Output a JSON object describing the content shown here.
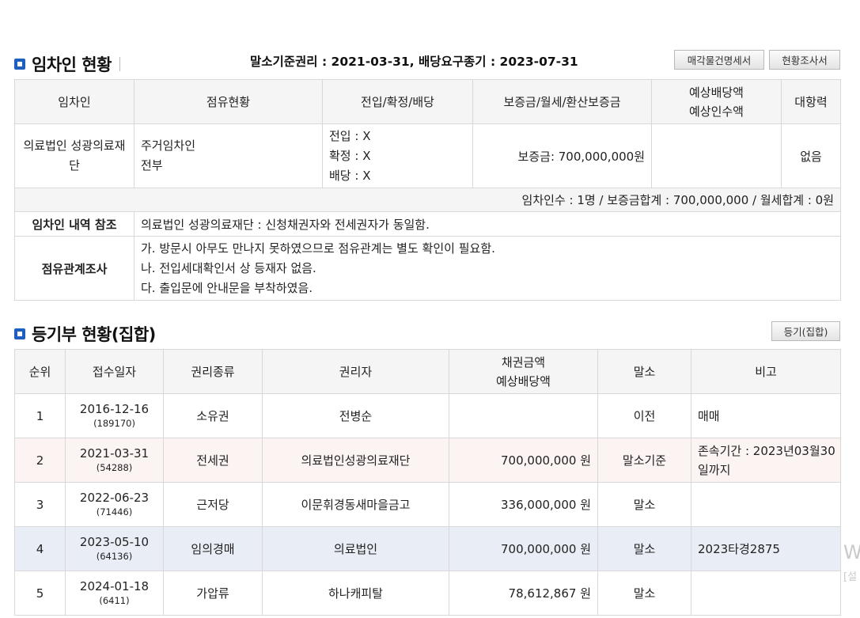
{
  "tenant_section": {
    "title": "임차인 현황",
    "criteria": "말소기준권리 : 2021-03-31, 배당요구종기 : 2023-07-31",
    "buttons": [
      "매각물건명세서",
      "현황조사서"
    ],
    "headers": [
      "임차인",
      "점유현황",
      "전입/확정/배당",
      "보증금/월세/환산보증금",
      "예상배당액",
      "예상인수액",
      "대항력"
    ],
    "row": {
      "tenant": "의료법인 성광의료재단",
      "occupancy_type": "주거임차인",
      "occupancy_part": "전부",
      "move_in": "전입 : X",
      "confirm": "확정 : X",
      "dividend": "배당 : X",
      "deposit": "보증금: 700,000,000원",
      "expected": "",
      "opposition": "없음"
    },
    "summary": "임차인수 : 1명 / 보증금합계 : 700,000,000 / 월세합계 : 0원",
    "note_label": "임차인 내역 참조",
    "note_text": "의료법인 성광의료재단 : 신청채권자와 전세권자가 동일함.",
    "survey_label": "점유관계조사",
    "survey_lines": [
      "가. 방문시 아무도 만나지 못하였으므로 점유관계는 별도 확인이 필요함.",
      "나. 전입세대확인서 상 등재자 없음.",
      "다. 출입문에 안내문을 부착하였음."
    ]
  },
  "registry_section": {
    "title": "등기부 현황(집합)",
    "button": "등기(집합)",
    "headers": [
      "순위",
      "접수일자",
      "권리종류",
      "권리자",
      "채권금액",
      "예상배당액",
      "말소",
      "비고"
    ],
    "rows": [
      {
        "rank": "1",
        "date": "2016-12-16",
        "receipt": "(189170)",
        "type": "소유권",
        "holder": "전병순",
        "amount": "",
        "cancel": "이전",
        "note1": "매매",
        "note2": ""
      },
      {
        "rank": "2",
        "date": "2021-03-31",
        "receipt": "(54288)",
        "type": "전세권",
        "holder": "의료법인성광의료재단",
        "amount": "700,000,000 원",
        "cancel": "말소기준",
        "note1": "존속기간 : 2023년03월30",
        "note2": "일까지"
      },
      {
        "rank": "3",
        "date": "2022-06-23",
        "receipt": "(71446)",
        "type": "근저당",
        "holder": "이문휘경동새마을금고",
        "amount": "336,000,000 원",
        "cancel": "말소",
        "note1": "",
        "note2": ""
      },
      {
        "rank": "4",
        "date": "2023-05-10",
        "receipt": "(64136)",
        "type": "임의경매",
        "holder": "의료법인",
        "amount": "700,000,000 원",
        "cancel": "말소",
        "note1": "2023타경2875",
        "note2": ""
      },
      {
        "rank": "5",
        "date": "2024-01-18",
        "receipt": "(6411)",
        "type": "가압류",
        "holder": "하나캐피탈",
        "amount": "78,612,867 원",
        "cancel": "말소",
        "note1": "",
        "note2": ""
      }
    ]
  },
  "edge_overlay": {
    "w": "W",
    "s": "[설"
  },
  "colors": {
    "accent": "#1f5fbf",
    "pink_row": "#fcf3f3",
    "blue_row": "#e9edf6",
    "header_bg": "#f5f5f5"
  }
}
